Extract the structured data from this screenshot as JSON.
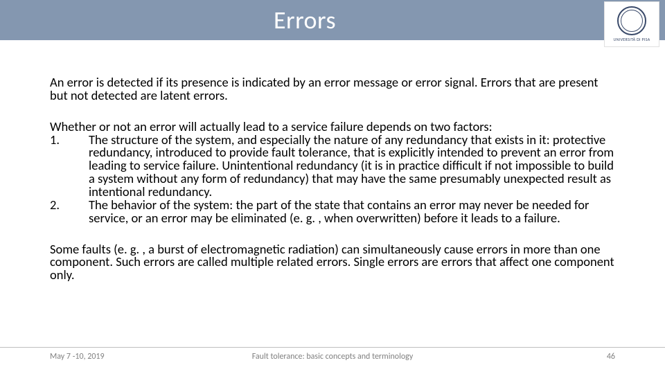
{
  "header": {
    "title": "Errors",
    "logo_caption": "UNIVERSITÀ DI PISA"
  },
  "content": {
    "p1": "An error is detected if its presence is indicated by an error message or error signal. Errors that are present but not detected are latent errors.",
    "p2_intro": "Whether or not an error will actually lead to a service failure depends on two factors:",
    "list": [
      {
        "num": "1.",
        "text": "The structure of the system, and especially the nature of any redundancy that exists in it: protective redundancy, introduced to provide fault tolerance, that is explicitly intended to prevent an error from leading to service failure. Unintentional redundancy (it is in practice difficult if not impossible to build a system without any form of redundancy) that may have the same presumably unexpected result as intentional redundancy."
      },
      {
        "num": "2.",
        "text": "The behavior of the system: the part of the state that contains an error may never be needed for service, or an error may be eliminated (e. g. , when overwritten) before it leads to a failure."
      }
    ],
    "p3": "Some faults (e. g. , a burst of electromagnetic radiation) can simultaneously cause errors in more than one component. Such errors are called multiple related errors. Single errors are errors that affect one component only."
  },
  "footer": {
    "date": "May 7 -10, 2019",
    "center": "Fault tolerance: basic concepts and terminology",
    "page": "46"
  }
}
